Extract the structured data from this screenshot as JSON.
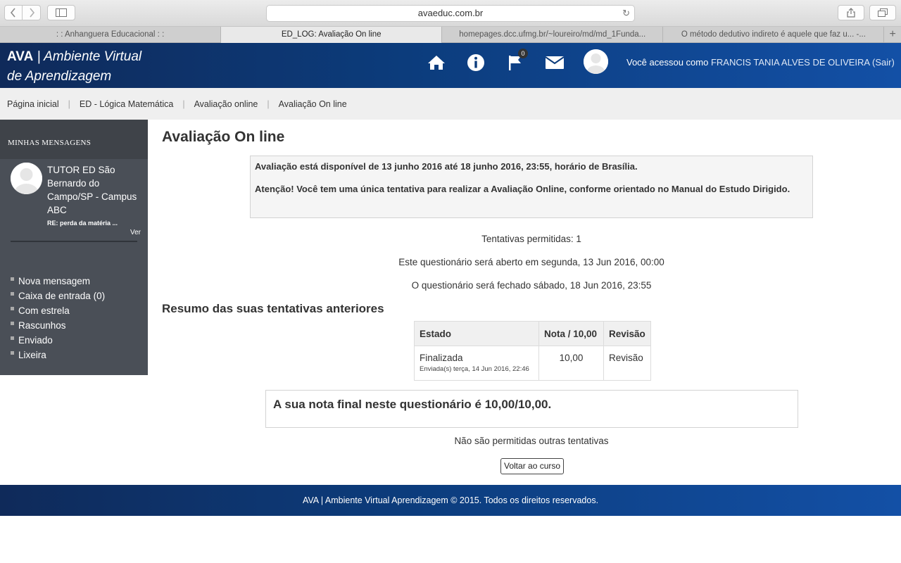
{
  "browser": {
    "url": "avaeduc.com.br",
    "tabs": [
      {
        "label": ": : Anhanguera Educacional : :",
        "active": false
      },
      {
        "label": "ED_LOG: Avaliação On line",
        "active": true
      },
      {
        "label": "homepages.dcc.ufmg.br/~loureiro/md/md_1Funda...",
        "active": false
      },
      {
        "label": "O método dedutivo indireto é aquele que faz u... -...",
        "active": false
      }
    ],
    "add_tab": "+"
  },
  "header": {
    "logo_line1_bold": "AVA",
    "logo_line1_rest": " | Ambiente Virtual",
    "logo_line2": "de Aprendizagem",
    "flag_badge": "0",
    "user_prefix": "Você acessou como ",
    "user_name": "FRANCIS TANIA ALVES DE OLIVEIRA (Sair)"
  },
  "breadcrumb": [
    "Página inicial",
    "ED - Lógica Matemática",
    "Avaliação online",
    "Avaliação On line"
  ],
  "messages": {
    "title": "MINHAS MENSAGENS",
    "sender": "TUTOR ED São Bernardo do Campo/SP - Campus ABC",
    "subject": "RE: perda da matéria ...",
    "view": "Ver",
    "menu": [
      "Nova mensagem",
      "Caixa de entrada (0)",
      "Com estrela",
      "Rascunhos",
      "Enviado",
      "Lixeira"
    ]
  },
  "main": {
    "title": "Avaliação On line",
    "info_line1": "Avaliação está disponível de 13 junho 2016 até 18 junho 2016, 23:55, horário de Brasília.",
    "info_line2": "Atenção! Você tem uma única tentativa para realizar a Avaliação Online, conforme orientado no Manual do Estudo Dirigido.",
    "attempts_allowed": "Tentativas permitidas: 1",
    "opens": "Este questionário será aberto em segunda, 13 Jun 2016, 00:00",
    "closes": "O questionário será fechado sábado, 18 Jun 2016, 23:55",
    "summary_title": "Resumo das suas tentativas anteriores",
    "table": {
      "headers": [
        "Estado",
        "Nota / 10,00",
        "Revisão"
      ],
      "row": {
        "state": "Finalizada",
        "submitted": "Enviada(s) terça, 14 Jun 2016, 22:46",
        "grade": "10,00",
        "review": "Revisão"
      }
    },
    "final_grade": "A sua nota final neste questionário é 10,00/10,00.",
    "no_more": "Não são permitidas outras tentativas",
    "back_button": "Voltar ao curso"
  },
  "footer": "AVA | Ambiente Virtual Aprendizagem © 2015. Todos os direitos reservados."
}
